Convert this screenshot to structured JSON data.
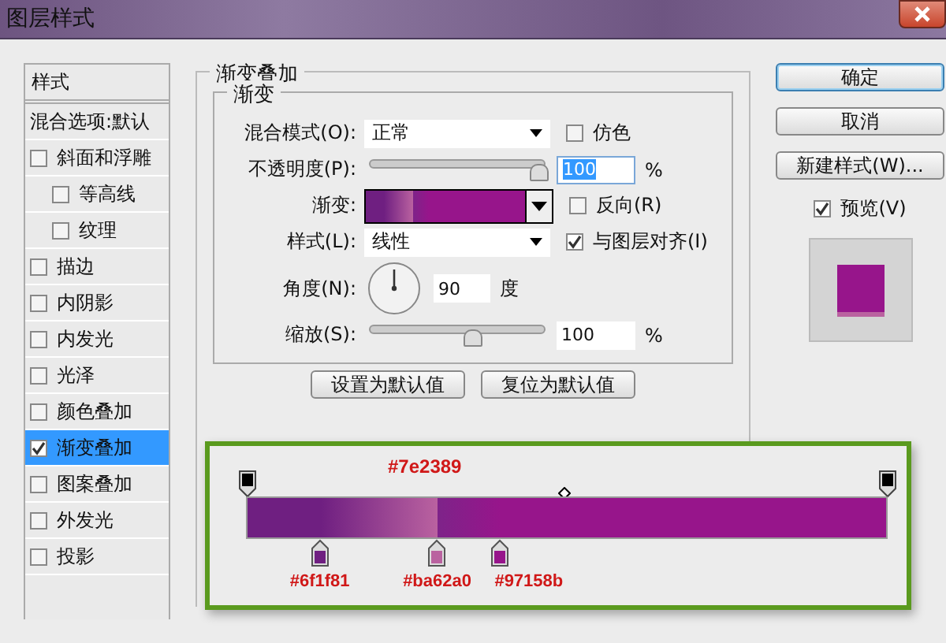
{
  "window": {
    "title": "图层样式"
  },
  "sidebar": {
    "header": "样式",
    "items": [
      {
        "label": "混合选项:默认",
        "kind": "plain",
        "selected": false
      },
      {
        "label": "斜面和浮雕",
        "kind": "check",
        "checked": false,
        "selected": false,
        "children": [
          {
            "label": "等高线",
            "kind": "check",
            "checked": false,
            "selected": false
          },
          {
            "label": "纹理",
            "kind": "check",
            "checked": false,
            "selected": false
          }
        ]
      },
      {
        "label": "描边",
        "kind": "check",
        "checked": false,
        "selected": false
      },
      {
        "label": "内阴影",
        "kind": "check",
        "checked": false,
        "selected": false
      },
      {
        "label": "内发光",
        "kind": "check",
        "checked": false,
        "selected": false
      },
      {
        "label": "光泽",
        "kind": "check",
        "checked": false,
        "selected": false
      },
      {
        "label": "颜色叠加",
        "kind": "check",
        "checked": false,
        "selected": false
      },
      {
        "label": "渐变叠加",
        "kind": "check",
        "checked": true,
        "selected": true
      },
      {
        "label": "图案叠加",
        "kind": "check",
        "checked": false,
        "selected": false
      },
      {
        "label": "外发光",
        "kind": "check",
        "checked": false,
        "selected": false
      },
      {
        "label": "投影",
        "kind": "check",
        "checked": false,
        "selected": false
      }
    ]
  },
  "panel": {
    "title": "渐变叠加",
    "group_title": "渐变",
    "blend_mode": {
      "label": "混合模式(O):",
      "value": "正常"
    },
    "dither": {
      "label": "仿色",
      "checked": false
    },
    "opacity": {
      "label": "不透明度(P):",
      "level": 1,
      "value": "100",
      "selected": true,
      "unit": "%"
    },
    "gradient": {
      "label": "渐变:"
    },
    "reverse": {
      "label": "反向(R)",
      "checked": false
    },
    "style": {
      "label": "样式(L):",
      "value": "线性"
    },
    "align": {
      "label": "与图层对齐(I)",
      "checked": true
    },
    "angle": {
      "label": "角度(N):",
      "value": "90",
      "unit": "度"
    },
    "scale": {
      "label": "缩放(S):",
      "level": 0.6,
      "value": "100",
      "unit": "%"
    },
    "buttons": [
      "设置为默认值",
      "复位为默认值"
    ]
  },
  "actions": {
    "buttons": [
      {
        "label": "确定",
        "kind": "default"
      },
      {
        "label": "取消",
        "kind": "normal"
      },
      {
        "label": "新建样式(W)...",
        "kind": "normal"
      }
    ],
    "preview": {
      "label": "预览(V)",
      "checked": true
    }
  },
  "gradient_editor": {
    "top_label": {
      "text": "#7e2389",
      "color": "#7e2389"
    },
    "color_stops": [
      {
        "label": "#6f1f81",
        "color": "#6f1f81"
      },
      {
        "label": "#ba62a0",
        "color": "#ba62a0"
      },
      {
        "label": "#97158b",
        "color": "#97158b"
      }
    ]
  }
}
